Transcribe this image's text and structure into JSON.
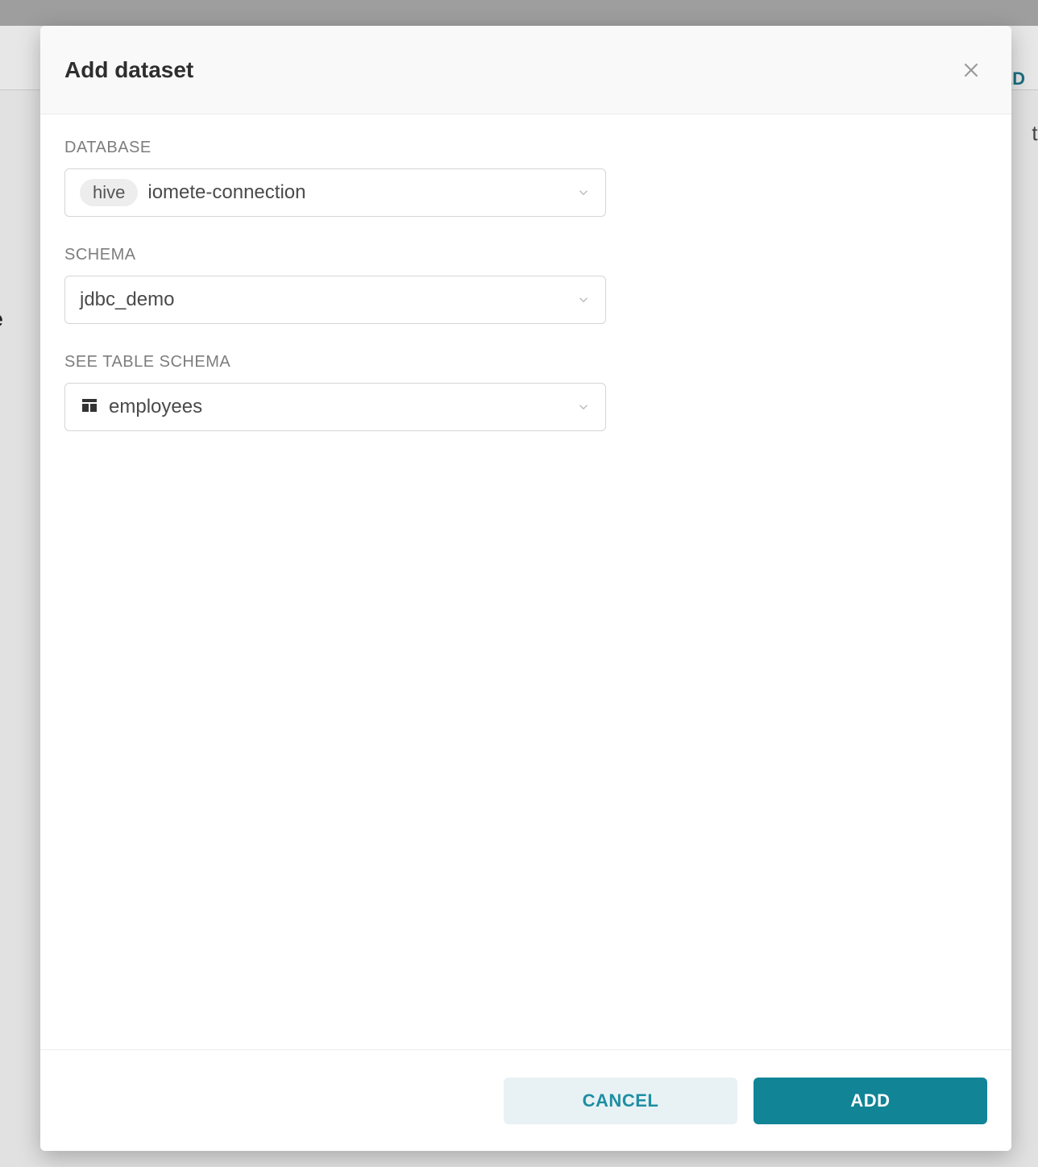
{
  "background": {
    "hint_left": "e a",
    "hint_right": "t or",
    "hint_topright": "ED",
    "hint_sideleft": "oase"
  },
  "modal": {
    "title": "Add dataset",
    "fields": {
      "database": {
        "label": "DATABASE",
        "tag": "hive",
        "value": "iomete-connection"
      },
      "schema": {
        "label": "SCHEMA",
        "value": "jdbc_demo"
      },
      "table": {
        "label": "SEE TABLE SCHEMA",
        "value": "employees"
      }
    },
    "buttons": {
      "cancel": "CANCEL",
      "add": "ADD"
    }
  }
}
